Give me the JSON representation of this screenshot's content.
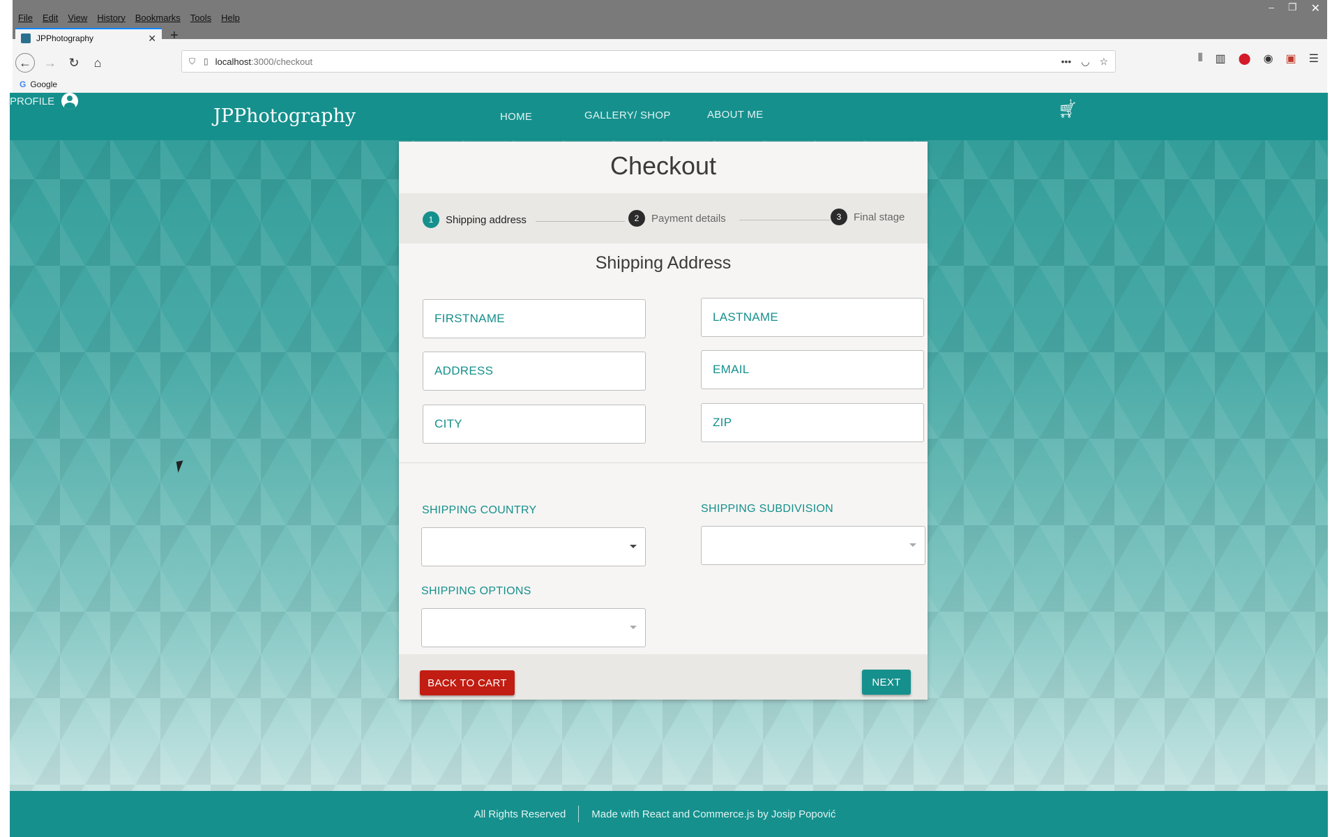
{
  "browser": {
    "menus": [
      "File",
      "Edit",
      "View",
      "History",
      "Bookmarks",
      "Tools",
      "Help"
    ],
    "tab_title": "JPPhotography",
    "url_host": "localhost",
    "url_path": ":3000/checkout",
    "bookmark_google": "Google"
  },
  "site": {
    "logo": "JPPhotography",
    "nav": {
      "home": "HOME",
      "gallery": "GALLERY/ SHOP",
      "about": "ABOUT ME",
      "profile": "PROFILE"
    },
    "cart_count": "1"
  },
  "checkout": {
    "title": "Checkout",
    "steps": [
      {
        "num": "1",
        "label": "Shipping address"
      },
      {
        "num": "2",
        "label": "Payment details"
      },
      {
        "num": "3",
        "label": "Final stage"
      }
    ],
    "section_title": "Shipping Address",
    "fields": {
      "firstname": "FIRSTNAME",
      "lastname": "LASTNAME",
      "address": "ADDRESS",
      "email": "EMAIL",
      "city": "CITY",
      "zip": "ZIP"
    },
    "selects": {
      "country_label": "SHIPPING COUNTRY",
      "subdivision_label": "SHIPPING SUBDIVISION",
      "options_label": "SHIPPING OPTIONS"
    },
    "buttons": {
      "back": "BACK TO CART",
      "next": "NEXT"
    }
  },
  "footer": {
    "rights": "All Rights Reserved",
    "made_with": "Made with React and Commerce.js by Josip Popović"
  },
  "colors": {
    "teal": "#15908d",
    "red": "#c11d12"
  }
}
